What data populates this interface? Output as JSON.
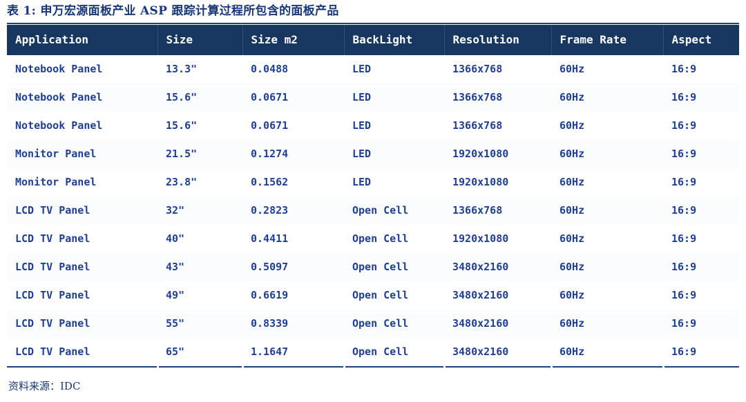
{
  "title": "表 1: 申万宏源面板产业 ASP 跟踪计算过程所包含的面板产品",
  "source_note": "资料来源：IDC",
  "colors": {
    "title_text": "#19387a",
    "header_background": "#173760",
    "header_text": "#ffffff",
    "cell_text": "#1f3f94",
    "rule": "#1c4077"
  },
  "table": {
    "columns": [
      "Application",
      "Size",
      "Size m2",
      "BackLight",
      "Resolution",
      "Frame Rate",
      "Aspect"
    ],
    "rows": [
      [
        "Notebook Panel",
        "13.3\"",
        "0.0488",
        "LED",
        "1366x768",
        "60Hz",
        "16:9"
      ],
      [
        "Notebook Panel",
        "15.6\"",
        "0.0671",
        "LED",
        "1366x768",
        "60Hz",
        "16:9"
      ],
      [
        "Notebook Panel",
        "15.6\"",
        "0.0671",
        "LED",
        "1366x768",
        "60Hz",
        "16:9"
      ],
      [
        "Monitor Panel",
        "21.5\"",
        "0.1274",
        "LED",
        "1920x1080",
        "60Hz",
        "16:9"
      ],
      [
        "Monitor Panel",
        "23.8\"",
        "0.1562",
        "LED",
        "1920x1080",
        "60Hz",
        "16:9"
      ],
      [
        "LCD TV Panel",
        "32\"",
        "0.2823",
        "Open Cell",
        "1366x768",
        "60Hz",
        "16:9"
      ],
      [
        "LCD TV Panel",
        "40\"",
        "0.4411",
        "Open Cell",
        "1920x1080",
        "60Hz",
        "16:9"
      ],
      [
        "LCD TV Panel",
        "43\"",
        "0.5097",
        "Open Cell",
        "3480x2160",
        "60Hz",
        "16:9"
      ],
      [
        "LCD TV Panel",
        "49\"",
        "0.6619",
        "Open Cell",
        "3480x2160",
        "60Hz",
        "16:9"
      ],
      [
        "LCD TV Panel",
        "55\"",
        "0.8339",
        "Open Cell",
        "3480x2160",
        "60Hz",
        "16:9"
      ],
      [
        "LCD TV Panel",
        "65\"",
        "1.1647",
        "Open Cell",
        "3480x2160",
        "60Hz",
        "16:9"
      ]
    ]
  }
}
